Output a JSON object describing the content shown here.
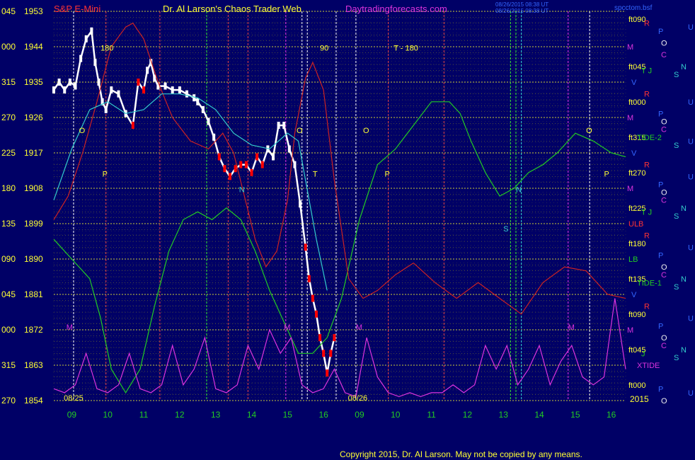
{
  "header": {
    "symbol": "S&P E-Mini",
    "title": "Dr. Al Larson's Chaos Trader Web",
    "site": "Daytradingforecasts.com",
    "stamp_line1": "08/26/2015 08:38 UT",
    "stamp_line2": "08/26/2015 08:38 UT",
    "file": "spcctom.bsf"
  },
  "footer": {
    "copyright": "Copyright 2015, Dr. Al Larson. May not be copied by any means."
  },
  "colors": {
    "background": "#000066",
    "price_white": "#ffffff",
    "price_red": "#ff0000",
    "grid_yellow": "#c8c800",
    "label_yellow": "#ffff33",
    "green": "#22cc22",
    "cyan": "#33cccc",
    "magenta": "#dd33dd",
    "red_line": "#cc2222",
    "blue_text": "#3366ff"
  },
  "chart_data": {
    "type": "line",
    "title": "S&P E-Mini",
    "xlabel": "",
    "ylabel": "",
    "ylim": [
      1854,
      1953
    ],
    "y_ticks": [
      1854,
      1863,
      1872,
      1881,
      1890,
      1899,
      1908,
      1917,
      1926,
      1935,
      1944,
      1953
    ],
    "angle_ticks": [
      "270",
      "315",
      "000",
      "045",
      "090",
      "135",
      "180",
      "225",
      "270",
      "315",
      "000",
      "045"
    ],
    "x_tick_labels": [
      "09",
      "10",
      "11",
      "12",
      "13",
      "14",
      "15",
      "16",
      "09",
      "10",
      "11",
      "12",
      "13",
      "14",
      "15",
      "16"
    ],
    "x_tick_positions": [
      0.5,
      1.5,
      2.5,
      3.5,
      4.5,
      5.5,
      6.5,
      7.5,
      8.5,
      9.5,
      10.5,
      11.5,
      12.5,
      13.5,
      14.5,
      15.5
    ],
    "xlim": [
      0,
      15.9
    ],
    "date_labels": [
      {
        "text": "08/25",
        "x": 0.55
      },
      {
        "text": "08/26",
        "x": 8.45
      }
    ],
    "year_label": "2015",
    "grid": true,
    "right_labels": [
      {
        "text": "ft090",
        "y": 1951
      },
      {
        "text": "R",
        "y": 1950
      },
      {
        "text": "P",
        "y": 1948
      },
      {
        "text": "U",
        "y": 1949
      },
      {
        "text": "M",
        "y": 1944
      },
      {
        "text": "O",
        "y": 1945
      },
      {
        "text": "C",
        "y": 1942
      },
      {
        "text": "ft045",
        "y": 1939
      },
      {
        "text": "T J",
        "y": 1938
      },
      {
        "text": "S",
        "y": 1937
      },
      {
        "text": "N",
        "y": 1939
      },
      {
        "text": "V",
        "y": 1935
      },
      {
        "text": "R",
        "y": 1932
      },
      {
        "text": "ft000",
        "y": 1930
      },
      {
        "text": "U",
        "y": 1930
      },
      {
        "text": "M",
        "y": 1926
      },
      {
        "text": "P",
        "y": 1927
      },
      {
        "text": "O",
        "y": 1925
      },
      {
        "text": "C",
        "y": 1923
      },
      {
        "text": "ft315",
        "y": 1921
      },
      {
        "text": "TIDE-2",
        "y": 1921
      },
      {
        "text": "S",
        "y": 1919
      },
      {
        "text": "U",
        "y": 1920
      },
      {
        "text": "V",
        "y": 1917
      },
      {
        "text": "R",
        "y": 1914
      },
      {
        "text": "ft270",
        "y": 1912
      },
      {
        "text": "U",
        "y": 1911
      },
      {
        "text": "P",
        "y": 1909
      },
      {
        "text": "M",
        "y": 1908
      },
      {
        "text": "O",
        "y": 1907
      },
      {
        "text": "C",
        "y": 1905
      },
      {
        "text": "ft225",
        "y": 1903
      },
      {
        "text": "T J",
        "y": 1902
      },
      {
        "text": "S",
        "y": 1901
      },
      {
        "text": "N",
        "y": 1903
      },
      {
        "text": "ULB",
        "y": 1899
      },
      {
        "text": "R",
        "y": 1896
      },
      {
        "text": "ft180",
        "y": 1894
      },
      {
        "text": "U",
        "y": 1893
      },
      {
        "text": "P",
        "y": 1891
      },
      {
        "text": "LB",
        "y": 1890
      },
      {
        "text": "O",
        "y": 1888
      },
      {
        "text": "C",
        "y": 1886
      },
      {
        "text": "ft135",
        "y": 1885
      },
      {
        "text": "TIDE-1",
        "y": 1884
      },
      {
        "text": "S",
        "y": 1883
      },
      {
        "text": "N",
        "y": 1885
      },
      {
        "text": "V",
        "y": 1881
      },
      {
        "text": "R",
        "y": 1878
      },
      {
        "text": "ft090",
        "y": 1876
      },
      {
        "text": "U",
        "y": 1875
      },
      {
        "text": "P",
        "y": 1873
      },
      {
        "text": "M",
        "y": 1872
      },
      {
        "text": "O",
        "y": 1870
      },
      {
        "text": "C",
        "y": 1868
      },
      {
        "text": "ft045",
        "y": 1867
      },
      {
        "text": "J",
        "y": 1866
      },
      {
        "text": "S",
        "y": 1865
      },
      {
        "text": "N",
        "y": 1867
      },
      {
        "text": "XTIDE",
        "y": 1863
      },
      {
        "text": "ft000",
        "y": 1858
      },
      {
        "text": "P",
        "y": 1857
      },
      {
        "text": "U",
        "y": 1856
      },
      {
        "text": "O",
        "y": 1854
      }
    ],
    "annotations": [
      {
        "text": "180",
        "x": 1.3,
        "y": 1943
      },
      {
        "text": "90",
        "x": 7.4,
        "y": 1943
      },
      {
        "text": "T - 180",
        "x": 9.45,
        "y": 1943
      },
      {
        "text": "O",
        "x": 0.7,
        "y": 1922
      },
      {
        "text": "P",
        "x": 1.35,
        "y": 1911
      },
      {
        "text": "O",
        "x": 6.75,
        "y": 1922
      },
      {
        "text": "T",
        "x": 7.2,
        "y": 1911
      },
      {
        "text": "O",
        "x": 8.6,
        "y": 1922
      },
      {
        "text": "P",
        "x": 9.2,
        "y": 1911
      },
      {
        "text": "N",
        "x": 5.15,
        "y": 1907
      },
      {
        "text": "N",
        "x": 12.85,
        "y": 1907
      },
      {
        "text": "S",
        "x": 12.5,
        "y": 1897
      },
      {
        "text": "O",
        "x": 14.8,
        "y": 1922
      },
      {
        "text": "P",
        "x": 15.3,
        "y": 1911
      },
      {
        "text": "M",
        "x": 0.35,
        "y": 1872
      },
      {
        "text": "M",
        "x": 6.4,
        "y": 1872
      },
      {
        "text": "M",
        "x": 8.4,
        "y": 1872
      },
      {
        "text": "M",
        "x": 14.3,
        "y": 1872
      }
    ],
    "series": [
      {
        "name": "",
        "role": "price",
        "x": [
          0.0,
          0.15,
          0.3,
          0.45,
          0.6,
          0.75,
          0.9,
          1.05,
          1.15,
          1.25,
          1.35,
          1.45,
          1.6,
          1.8,
          2.0,
          2.2,
          2.35,
          2.5,
          2.6,
          2.7,
          2.8,
          2.9,
          3.1,
          3.3,
          3.5,
          3.7,
          3.9,
          4.0,
          4.15,
          4.3,
          4.45,
          4.6,
          4.75,
          4.9,
          5.05,
          5.2,
          5.35,
          5.5,
          5.65,
          5.8,
          5.95,
          6.1,
          6.25,
          6.4,
          6.55,
          6.7,
          6.85,
          7.0,
          7.1,
          7.2,
          7.3,
          7.4,
          7.5,
          7.6,
          7.7,
          7.8
        ],
        "y": [
          1933,
          1935,
          1933,
          1935,
          1934,
          1941,
          1946,
          1948,
          1940,
          1935,
          1930,
          1928,
          1933,
          1932,
          1927,
          1924,
          1935,
          1933,
          1938,
          1940,
          1936,
          1934,
          1934,
          1933,
          1933,
          1932,
          1931,
          1930,
          1928,
          1925,
          1921,
          1916,
          1913,
          1911,
          1913,
          1914,
          1914,
          1912,
          1916,
          1914,
          1918,
          1916,
          1924,
          1924,
          1918,
          1914,
          1904,
          1893,
          1885,
          1880,
          1876,
          1870,
          1866,
          1861,
          1866,
          1870
        ]
      },
      {
        "name": "",
        "role": "cycle-green",
        "x": [
          0.0,
          0.5,
          1.0,
          1.3,
          1.6,
          2.0,
          2.4,
          2.8,
          3.2,
          3.6,
          4.0,
          4.4,
          4.8,
          5.2,
          5.6,
          6.0,
          6.4,
          6.8,
          7.2,
          7.6,
          8.0,
          8.5,
          9.0,
          9.5,
          10.0,
          10.5,
          11.0,
          11.3,
          11.6,
          12.0,
          12.4,
          12.8,
          13.2,
          13.6,
          14.0,
          14.5,
          15.0,
          15.5,
          15.9
        ],
        "y": [
          1895,
          1890,
          1885,
          1875,
          1862,
          1856,
          1862,
          1878,
          1892,
          1900,
          1902,
          1900,
          1903,
          1900,
          1892,
          1882,
          1874,
          1866,
          1866,
          1870,
          1880,
          1900,
          1914,
          1918,
          1924,
          1930,
          1930,
          1927,
          1920,
          1912,
          1906,
          1908,
          1912,
          1914,
          1917,
          1922,
          1920,
          1917,
          1916
        ]
      },
      {
        "name": "",
        "role": "cycle-red",
        "x": [
          0.0,
          0.4,
          0.8,
          1.2,
          1.6,
          2.0,
          2.2,
          2.5,
          2.9,
          3.3,
          3.8,
          4.3,
          4.7,
          5.0,
          5.3,
          5.6,
          5.9,
          6.2,
          6.5,
          6.7,
          7.0,
          7.2,
          7.5,
          7.8,
          8.2,
          8.6,
          9.0,
          9.5,
          10.0,
          10.6,
          11.2,
          11.8,
          12.4,
          13.0,
          13.6,
          14.2,
          14.8,
          15.4,
          15.9
        ],
        "y": [
          1900,
          1906,
          1917,
          1930,
          1944,
          1949,
          1950,
          1946,
          1935,
          1926,
          1920,
          1918,
          1922,
          1917,
          1906,
          1895,
          1888,
          1892,
          1905,
          1922,
          1936,
          1940,
          1933,
          1910,
          1885,
          1880,
          1882,
          1886,
          1889,
          1884,
          1880,
          1884,
          1880,
          1876,
          1884,
          1888,
          1887,
          1881,
          1880
        ]
      },
      {
        "name": "",
        "role": "cycle-cyan",
        "x": [
          0.0,
          0.5,
          1.0,
          1.5,
          2.0,
          2.5,
          3.0,
          3.5,
          4.0,
          4.5,
          5.0,
          5.5,
          6.0,
          6.5,
          6.8,
          7.0,
          7.3,
          7.6
        ],
        "y": [
          1905,
          1918,
          1928,
          1930,
          1927,
          1928,
          1932,
          1932,
          1931,
          1928,
          1922,
          1919,
          1918,
          1922,
          1920,
          1910,
          1895,
          1882
        ]
      },
      {
        "name": "",
        "role": "tide-magenta",
        "x": [
          0.0,
          0.3,
          0.6,
          0.9,
          1.2,
          1.5,
          1.8,
          2.1,
          2.4,
          2.7,
          3.0,
          3.3,
          3.6,
          3.9,
          4.2,
          4.5,
          4.8,
          5.1,
          5.4,
          5.7,
          6.0,
          6.3,
          6.6,
          6.9,
          7.2,
          7.5,
          7.8,
          8.1,
          8.4,
          8.7,
          9.0,
          9.3,
          9.6,
          9.9,
          10.2,
          10.5,
          10.8,
          11.1,
          11.4,
          11.7,
          12.0,
          12.3,
          12.6,
          12.9,
          13.2,
          13.5,
          13.8,
          14.1,
          14.4,
          14.7,
          15.0,
          15.3,
          15.6,
          15.9
        ],
        "y": [
          1857,
          1856,
          1858,
          1866,
          1857,
          1856,
          1858,
          1866,
          1857,
          1856,
          1858,
          1868,
          1858,
          1862,
          1870,
          1857,
          1856,
          1858,
          1868,
          1862,
          1872,
          1866,
          1870,
          1858,
          1856,
          1857,
          1862,
          1856,
          1855,
          1870,
          1860,
          1856,
          1855,
          1856,
          1855,
          1856,
          1856,
          1858,
          1856,
          1858,
          1868,
          1862,
          1868,
          1858,
          1862,
          1868,
          1858,
          1864,
          1868,
          1860,
          1858,
          1860,
          1880,
          1862
        ]
      }
    ],
    "vertical_lines": [
      {
        "x": 0.55,
        "color": "#eeeeee"
      },
      {
        "x": 1.45,
        "color": "#dd4444"
      },
      {
        "x": 2.95,
        "color": "#dd4444"
      },
      {
        "x": 4.25,
        "color": "#33dd33"
      },
      {
        "x": 4.85,
        "color": "#dd4444"
      },
      {
        "x": 5.4,
        "color": "#dd4444"
      },
      {
        "x": 6.45,
        "color": "#dd33dd"
      },
      {
        "x": 6.9,
        "color": "#eeeeee"
      },
      {
        "x": 7.05,
        "color": "#eeeeee"
      },
      {
        "x": 7.85,
        "color": "#eeeeee"
      },
      {
        "x": 8.4,
        "color": "#eeeeee"
      },
      {
        "x": 9.3,
        "color": "#dd4444"
      },
      {
        "x": 10.85,
        "color": "#dd4444"
      },
      {
        "x": 12.7,
        "color": "#33dd33"
      },
      {
        "x": 12.85,
        "color": "#33dd33"
      },
      {
        "x": 13.0,
        "color": "#33cccc"
      },
      {
        "x": 14.3,
        "color": "#dd33dd"
      },
      {
        "x": 14.9,
        "color": "#eeeeee"
      }
    ]
  }
}
